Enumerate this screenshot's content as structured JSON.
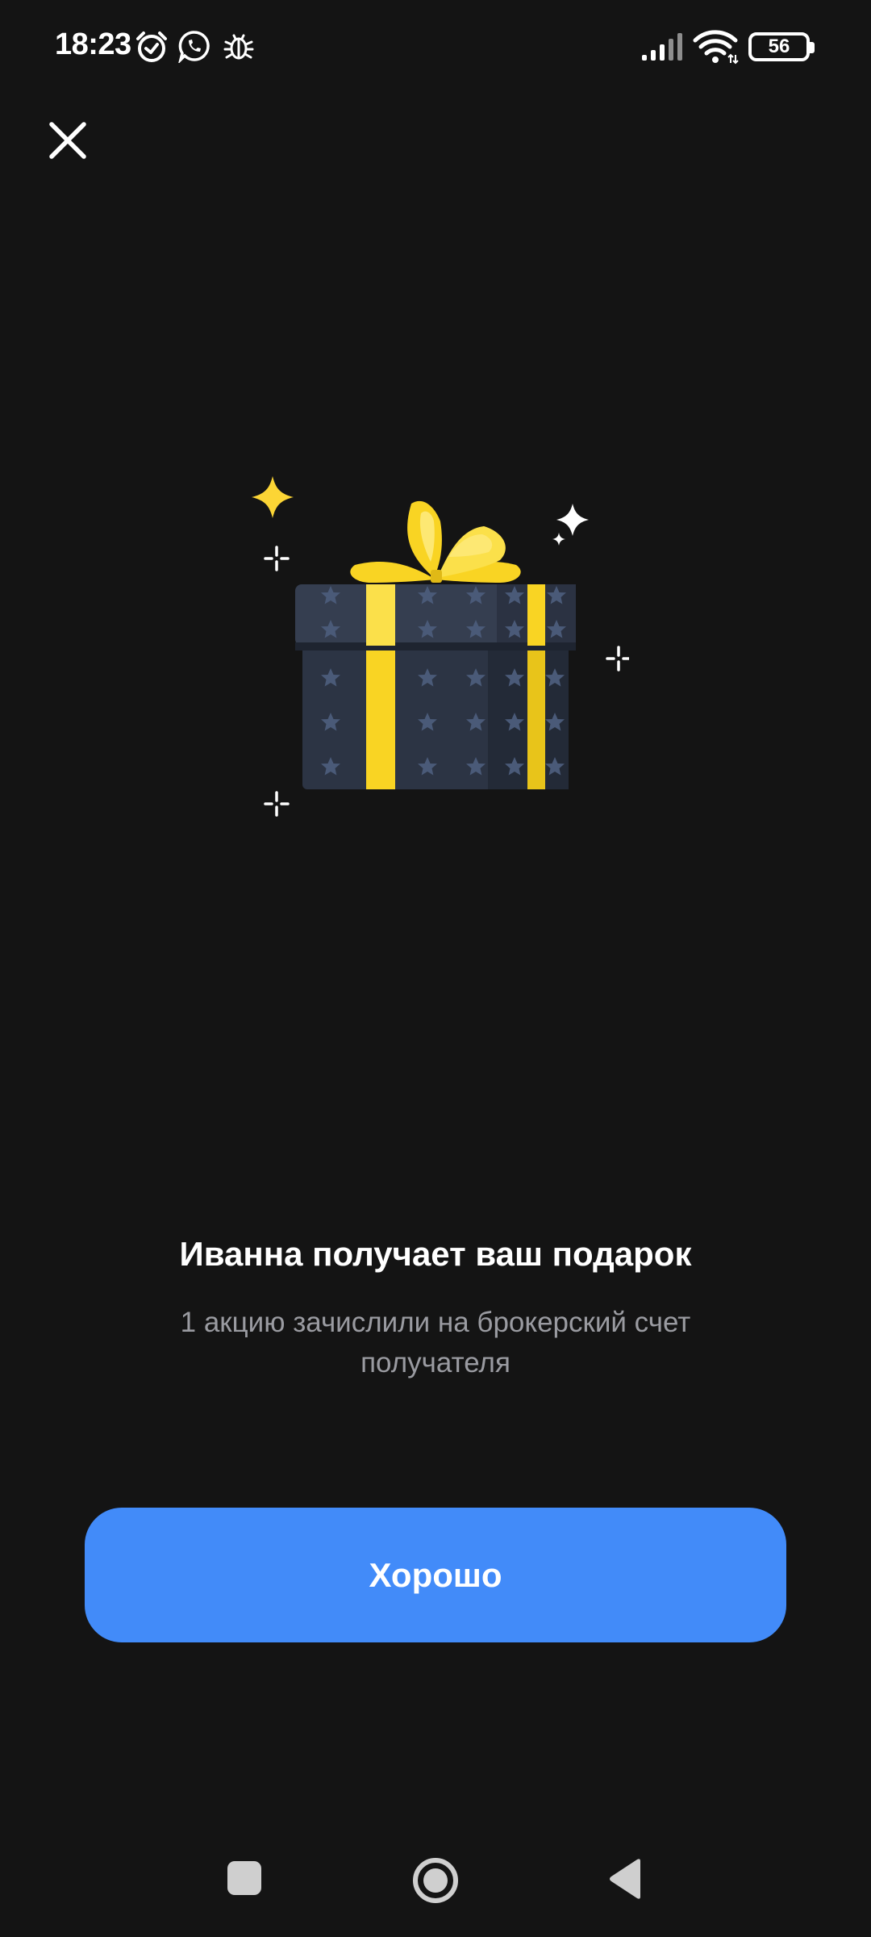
{
  "status_bar": {
    "time": "18:23",
    "battery_level": "56",
    "icons": [
      "alarm-icon",
      "whatsapp-icon",
      "bug-icon",
      "signal-icon",
      "wifi-icon",
      "battery-icon"
    ]
  },
  "header": {
    "close_icon": "close-icon"
  },
  "illustration": {
    "name": "gift-box",
    "colors": {
      "box": "#2c3444",
      "box_lid": "#353e50",
      "stars": "#4a5a78",
      "ribbon": "#f9d423",
      "bow": "#fbe04a",
      "sparkle_yellow": "#fcd535",
      "sparkle_white": "#ffffff"
    }
  },
  "content": {
    "title": "Иванна получает ваш подарок",
    "subtitle": "1 акцию зачислили на брокерский счет получателя"
  },
  "actions": {
    "ok_label": "Хорошо"
  },
  "nav_bar": {
    "items": [
      "recents-icon",
      "home-icon",
      "back-icon"
    ]
  },
  "colors": {
    "background": "#141414",
    "accent": "#428bf9",
    "text_primary": "#ffffff",
    "text_secondary": "#9a9ba1"
  }
}
